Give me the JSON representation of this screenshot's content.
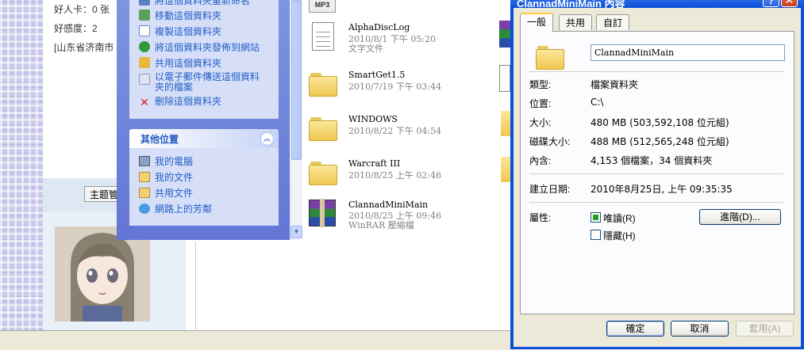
{
  "background_page": {
    "profile_lines": [
      "好人卡：0 张",
      "好感度：2",
      "[山东省济南市"
    ],
    "topic_button": "主题管",
    "avatar_icon": "anime-girl-avatar"
  },
  "explorer": {
    "tasks": [
      {
        "label": "將這個資料夾重新命名",
        "icon": "rename-icon",
        "color": "#5a7fc8"
      },
      {
        "label": "移動這個資料夾",
        "icon": "move-icon",
        "color": "#5aa05a"
      },
      {
        "label": "複製這個資料夾",
        "icon": "copy-icon",
        "color": "#8aa8e0"
      },
      {
        "label": "將這個資料夾發佈到網站",
        "icon": "publish-icon",
        "color": "#2e9a3c"
      },
      {
        "label": "共用這個資料夾",
        "icon": "share-icon",
        "color": "#e8b840"
      },
      {
        "label": "以電子郵件傳送這個資料夾的檔案",
        "icon": "email-icon",
        "color": "#c8d0e8"
      },
      {
        "label": "刪除這個資料夾",
        "icon": "delete-icon",
        "color": "#d02020"
      }
    ],
    "other_places_title": "其他位置",
    "other_places": [
      {
        "label": "我的電腦",
        "icon": "my-computer-icon"
      },
      {
        "label": "我的文件",
        "icon": "my-documents-icon"
      },
      {
        "label": "共用文件",
        "icon": "shared-documents-icon"
      },
      {
        "label": "網路上的芳鄰",
        "icon": "network-icon"
      }
    ],
    "files": [
      {
        "name": "AlphaDiscLog",
        "meta": "2010/8/1 下午 05:20",
        "meta2": "文字文件",
        "type": "text"
      },
      {
        "name": "SmartGet1.5",
        "meta": "2010/7/19 下午 03:44",
        "meta2": "",
        "type": "folder"
      },
      {
        "name": "WINDOWS",
        "meta": "2010/8/22 下午 04:54",
        "meta2": "",
        "type": "folder"
      },
      {
        "name": "Warcraft III",
        "meta": "2010/8/25 上午 02:46",
        "meta2": "",
        "type": "folder"
      },
      {
        "name": "ClannadMiniMain",
        "meta": "2010/8/25 上午 09:46",
        "meta2": "WinRAR 壓縮檔",
        "type": "rar"
      }
    ],
    "partial_top_label": "MP3"
  },
  "dialog": {
    "title": "ClannadMiniMain 內容",
    "tabs": [
      "一般",
      "共用",
      "自訂"
    ],
    "active_tab": "一般",
    "folder_name": "ClannadMiniMain",
    "props": [
      {
        "label": "類型:",
        "value": "檔案資料夾"
      },
      {
        "label": "位置:",
        "value": "C:\\"
      },
      {
        "label": "大小:",
        "value": "480 MB (503,592,108 位元組)"
      },
      {
        "label": "磁碟大小:",
        "value": "488 MB (512,565,248 位元組)"
      },
      {
        "label": "內含:",
        "value": "4,153 個檔案，34 個資料夾"
      }
    ],
    "created_label": "建立日期:",
    "created_value": "2010年8月25日, 上午 09:35:35",
    "attributes_label": "屬性:",
    "readonly_label": "唯讀(R)",
    "readonly_checked": true,
    "hidden_label": "隱藏(H)",
    "hidden_checked": false,
    "advanced_button": "進階(D)...",
    "ok_button": "確定",
    "cancel_button": "取消",
    "apply_button": "套用(A)",
    "help_glyph": "?",
    "close_glyph": "✕"
  }
}
